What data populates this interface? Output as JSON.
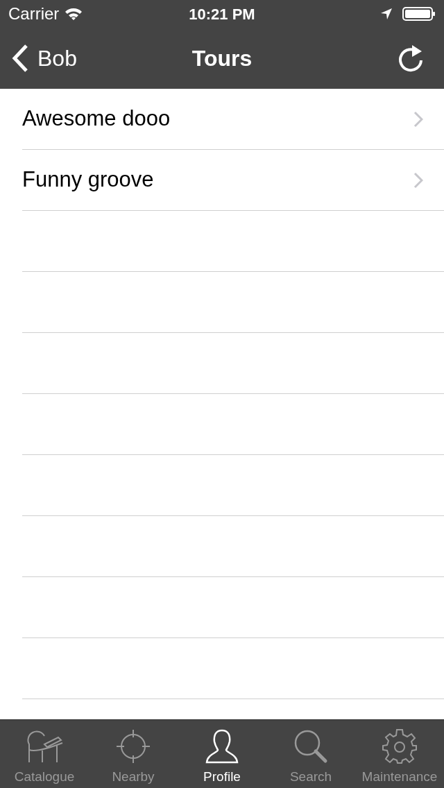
{
  "status_bar": {
    "carrier": "Carrier",
    "time": "10:21 PM"
  },
  "nav_bar": {
    "back": "Bob",
    "title": "Tours"
  },
  "list": [
    {
      "label": "Awesome dooo"
    },
    {
      "label": "Funny groove"
    }
  ],
  "tab_bar": [
    {
      "label": "Catalogue",
      "selected": false
    },
    {
      "label": "Nearby",
      "selected": false
    },
    {
      "label": "Profile",
      "selected": true
    },
    {
      "label": "Search",
      "selected": false
    },
    {
      "label": "Maintenance",
      "selected": false
    }
  ]
}
